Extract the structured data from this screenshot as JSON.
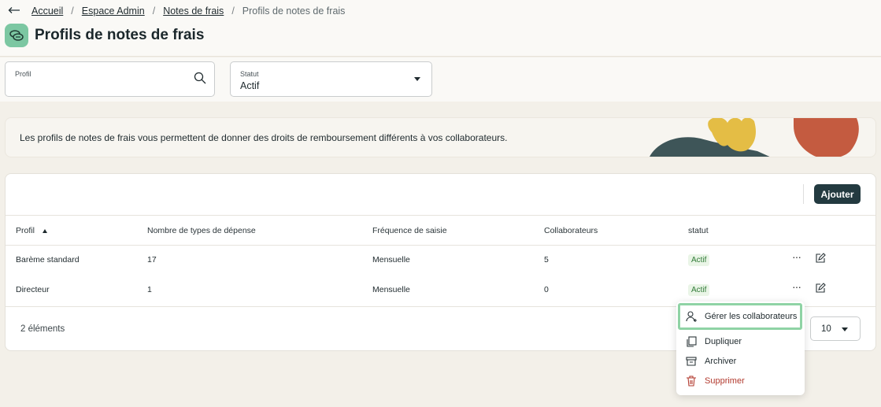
{
  "breadcrumb": {
    "back_icon": "arrow-left-icon",
    "items": [
      "Accueil",
      "Espace Admin",
      "Notes de frais"
    ],
    "current": "Profils de notes de frais"
  },
  "page": {
    "title": "Profils de notes de frais",
    "icon": "coins-icon",
    "icon_bg": "#7cc7a2"
  },
  "filters": {
    "profil": {
      "label": "Profil",
      "value": ""
    },
    "statut": {
      "label": "Statut",
      "value": "Actif"
    }
  },
  "banner": {
    "text": "Les profils de notes de frais vous permettent de donner des droits de remboursement différents à vos collaborateurs."
  },
  "toolbar": {
    "add_label": "Ajouter"
  },
  "table": {
    "columns": [
      "Profil",
      "Nombre de types de dépense",
      "Fréquence de saisie",
      "Collaborateurs",
      "statut"
    ],
    "sorted_column": "Profil",
    "sort_direction": "ascending",
    "rows": [
      {
        "profil": "Barème standard",
        "types": "17",
        "frequence": "Mensuelle",
        "collaborateurs": "5",
        "statut": "Actif"
      },
      {
        "profil": "Directeur",
        "types": "1",
        "frequence": "Mensuelle",
        "collaborateurs": "0",
        "statut": "Actif"
      }
    ],
    "more_label": "···",
    "count_label": "2 éléments",
    "page_size": "10"
  },
  "context_menu": {
    "items": [
      {
        "label": "Gérer les collaborateurs",
        "icon": "user-add-icon"
      },
      {
        "label": "Dupliquer",
        "icon": "copy-icon"
      },
      {
        "label": "Archiver",
        "icon": "archive-icon"
      },
      {
        "label": "Supprimer",
        "icon": "trash-icon"
      }
    ]
  },
  "colors": {
    "primary_button": "#233a40",
    "success_badge": "#2f7a36",
    "danger": "#b23a2e",
    "highlight_border": "#8fd3a5"
  }
}
